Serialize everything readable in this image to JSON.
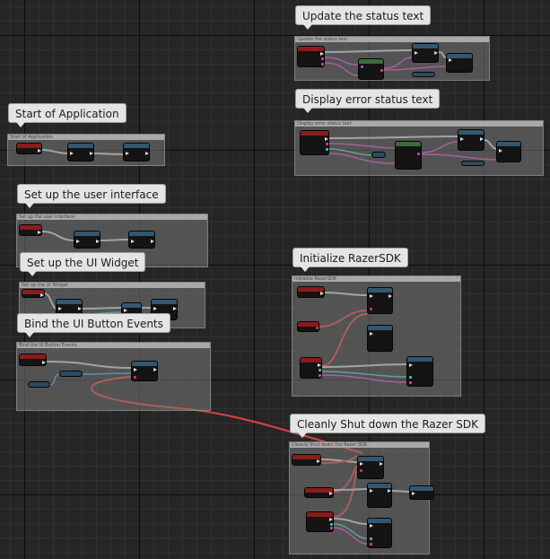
{
  "comments": [
    {
      "id": "update-status",
      "label": "Update the status text",
      "header": "Update the status text"
    },
    {
      "id": "display-error",
      "label": "Display error status text",
      "header": "Display error status text"
    },
    {
      "id": "start-app",
      "label": "Start of Application",
      "header": "Start of Application"
    },
    {
      "id": "setup-ui",
      "label": "Set up the user interface",
      "header": "Set up the user interface"
    },
    {
      "id": "setup-widget",
      "label": "Set up the UI Widget",
      "header": "Set up the UI Widget"
    },
    {
      "id": "bind-events",
      "label": "Bind the UI Button Events",
      "header": "Bind the UI Button Events"
    },
    {
      "id": "init-sdk",
      "label": "Initialize RazerSDK",
      "header": "Initialize RazerSDK"
    },
    {
      "id": "shutdown-sdk",
      "label": "Cleanly Shut down the Razer SDK",
      "header": "Cleanly Shut down the Razer SDK"
    }
  ],
  "colors": {
    "exec_wire": "#d8d8d8",
    "string_wire": "#e040c8",
    "object_wire": "#3ab0e0",
    "struct_wire": "#3fd6b0",
    "delegate_wire": "#e04040",
    "event_header": "#8a1c1c",
    "function_header": "#33576e"
  }
}
